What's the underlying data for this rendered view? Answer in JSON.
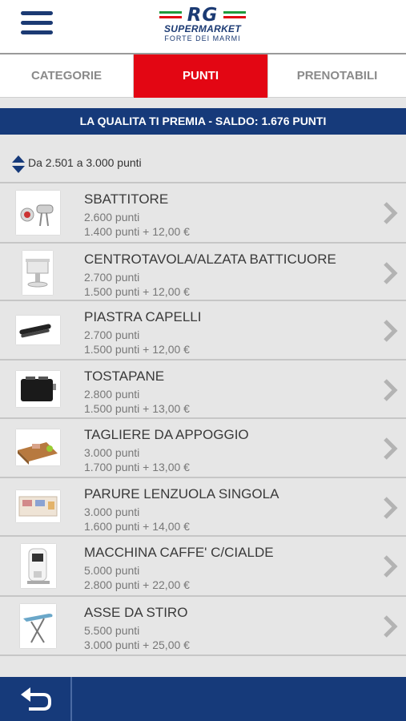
{
  "header": {
    "logo_text": "RG",
    "logo_sub": "SUPERMARKET",
    "logo_city": "FORTE DEI MARMI",
    "menu_icon": "hamburger-menu-icon",
    "colors": {
      "navy": "#163a7a",
      "red": "#e30613",
      "green": "#1f9a3c"
    }
  },
  "tabs": [
    {
      "label": "CATEGORIE",
      "active": false
    },
    {
      "label": "PUNTI",
      "active": true
    },
    {
      "label": "PRENOTABILI",
      "active": false
    }
  ],
  "banner": {
    "text": "LA QUALITA TI PREMIA - SALDO: 1.676 PUNTI"
  },
  "filter": {
    "label": "Da 2.501 a 3.000 punti",
    "icon": "sort-arrows-icon"
  },
  "items": [
    {
      "name": "SBATTITORE",
      "points": "2.600 punti",
      "mixed": "1.400 punti + 12,00 €",
      "image": "hand-mixer-image"
    },
    {
      "name": "CENTROTAVOLA/ALZATA BATTICUORE",
      "points": "2.700 punti",
      "mixed": "1.500 punti + 12,00 €",
      "image": "cake-stand-image"
    },
    {
      "name": "PIASTRA CAPELLI",
      "points": "2.700 punti",
      "mixed": "1.500 punti + 12,00 €",
      "image": "hair-straightener-image"
    },
    {
      "name": "TOSTAPANE",
      "points": "2.800 punti",
      "mixed": "1.500 punti + 13,00 €",
      "image": "toaster-image"
    },
    {
      "name": "TAGLIERE DA APPOGGIO",
      "points": "3.000 punti",
      "mixed": "1.700 punti + 13,00 €",
      "image": "cutting-board-image"
    },
    {
      "name": "PARURE LENZUOLA SINGOLA",
      "points": "3.000 punti",
      "mixed": "1.600 punti + 14,00 €",
      "image": "bed-sheets-image"
    },
    {
      "name": "MACCHINA CAFFE' C/CIALDE",
      "points": "5.000 punti",
      "mixed": "2.800 punti + 22,00 €",
      "image": "coffee-machine-image"
    },
    {
      "name": "ASSE DA STIRO",
      "points": "5.500 punti",
      "mixed": "3.000 punti + 25,00 €",
      "image": "ironing-board-image"
    }
  ],
  "footer": {
    "back_icon": "back-arrow-icon"
  }
}
